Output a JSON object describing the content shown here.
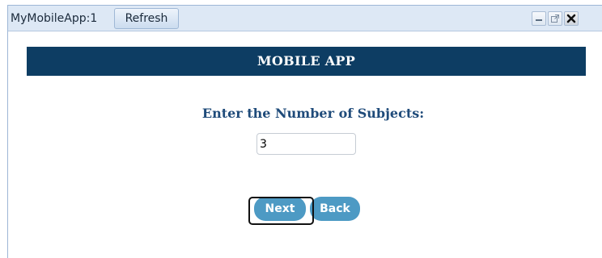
{
  "window": {
    "app_title": "MyMobileApp:1",
    "refresh_label": "Refresh",
    "controls": [
      "minimize-icon",
      "popout-icon",
      "close-icon"
    ]
  },
  "banner": {
    "title": "MOBILE APP"
  },
  "form": {
    "prompt": "Enter the Number of Subjects:",
    "subjects_value": "3"
  },
  "buttons": {
    "next_label": "Next",
    "back_label": "Back"
  },
  "colors": {
    "banner_bg": "#0d3d63",
    "prompt_text": "#1f4b7a",
    "button_bg": "#4d9ac4",
    "titlebar_bg": "#dde8f5"
  }
}
